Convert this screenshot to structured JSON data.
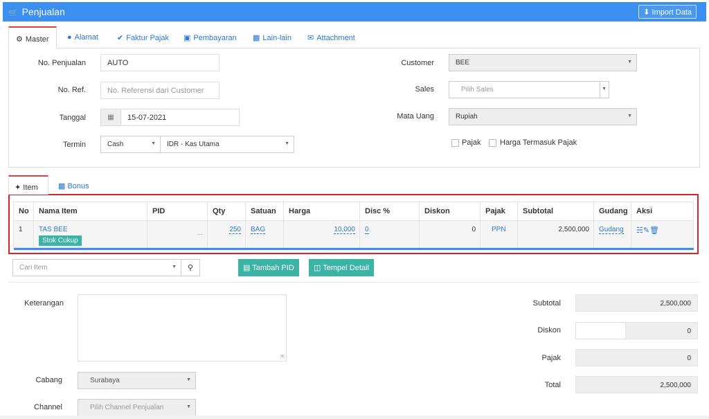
{
  "header": {
    "title": "Penjualan",
    "import_label": "Import Data"
  },
  "tabs": [
    "Master",
    "Alamat",
    "Faktur Pajak",
    "Pembayaran",
    "Lain-lain",
    "Attachment"
  ],
  "form": {
    "no_penjualan_label": "No. Penjualan",
    "no_penjualan_value": "AUTO",
    "no_ref_label": "No. Ref.",
    "no_ref_placeholder": "No. Referensi dari Customer",
    "tanggal_label": "Tanggal",
    "tanggal_value": "15-07-2021",
    "termin_label": "Termin",
    "termin_value": "Cash",
    "kas_value": "IDR - Kas Utama",
    "customer_label": "Customer",
    "customer_value": "BEE",
    "sales_label": "Sales",
    "sales_placeholder": "Pilih Sales",
    "mata_uang_label": "Mata Uang",
    "mata_uang_value": "Rupiah",
    "pajak_label": "Pajak",
    "harga_termasuk_pajak_label": "Harga Termasuk Pajak"
  },
  "subtabs": [
    "Item",
    "Bonus"
  ],
  "table": {
    "headers": [
      "No",
      "Nama Item",
      "PID",
      "Qty",
      "Satuan",
      "Harga",
      "Disc %",
      "Diskon",
      "Pajak",
      "Subtotal",
      "Gudang",
      "Aksi"
    ],
    "rows": [
      {
        "no": "1",
        "nama": "TAS BEE",
        "stok": "Stok Cukup",
        "pid": "...",
        "qty": "250",
        "satuan": "BAG",
        "harga": "10,000",
        "disc": "0",
        "diskon": "0",
        "pajak": "PPN",
        "subtotal": "2,500,000",
        "gudang": "Gudang"
      }
    ]
  },
  "actions": {
    "search_placeholder": "Cari Item",
    "tambah_pid": "Tambah PID",
    "tempel_detail": "Tempel Detail"
  },
  "footer": {
    "keterangan_label": "Keterangan",
    "cabang_label": "Cabang",
    "cabang_value": "Surabaya",
    "channel_label": "Channel",
    "channel_placeholder": "Pilih Channel Penjualan",
    "subtotal_label": "Subtotal",
    "subtotal_value": "2,500,000",
    "diskon_label": "Diskon",
    "diskon_value": "0",
    "pajak_label": "Pajak",
    "pajak_value": "0",
    "total_label": "Total",
    "total_value": "2,500,000"
  },
  "colors": {
    "primary": "#3b8ff0",
    "teal": "#3bb3a5",
    "highlight": "#d9232b"
  }
}
